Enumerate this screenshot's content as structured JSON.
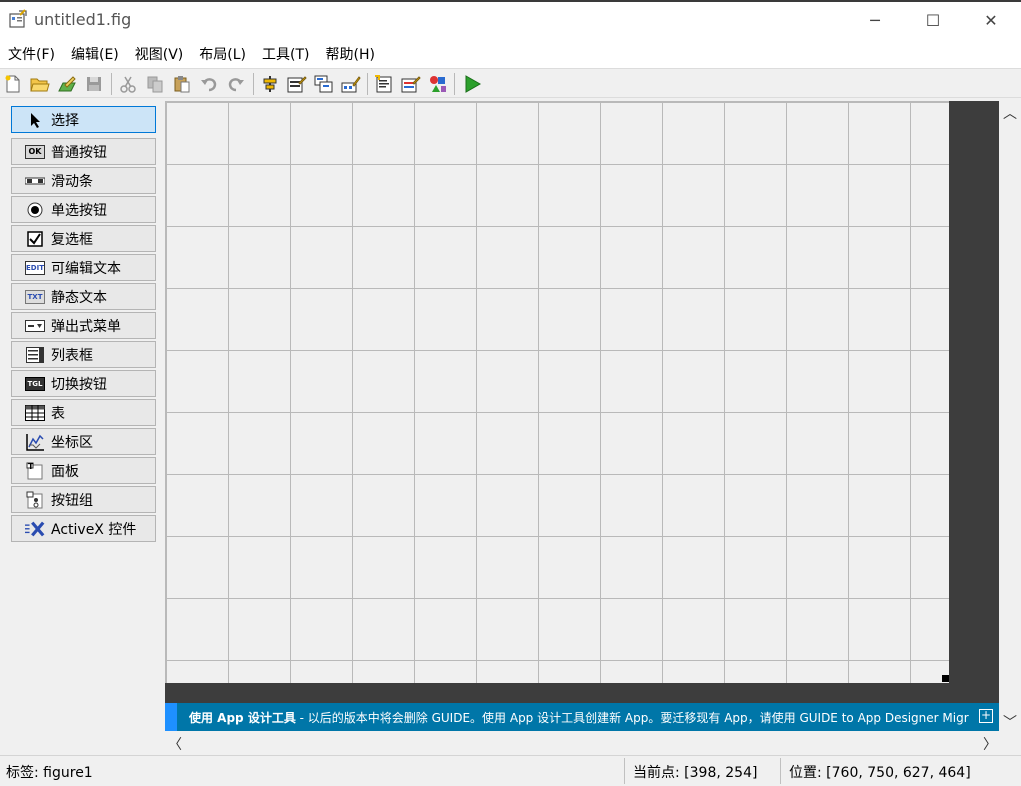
{
  "window": {
    "title": "untitled1.fig",
    "minimize": "─",
    "maximize": "☐",
    "close": "✕"
  },
  "menu": [
    {
      "label": "文件(F)"
    },
    {
      "label": "编辑(E)"
    },
    {
      "label": "视图(V)"
    },
    {
      "label": "布局(L)"
    },
    {
      "label": "工具(T)"
    },
    {
      "label": "帮助(H)"
    }
  ],
  "toolbar": {
    "icons": [
      "new-file-icon",
      "open-folder-icon",
      "edit-icon",
      "save-icon",
      "cut-icon",
      "copy-icon",
      "paste-icon",
      "undo-icon",
      "redo-icon",
      "align-icon",
      "menu-editor-icon",
      "tab-order-icon",
      "toolbar-editor-icon",
      "mfile-editor-icon",
      "property-inspector-icon",
      "object-browser-icon",
      "run-icon"
    ]
  },
  "palette": {
    "items": [
      {
        "label": "选择",
        "icon": "arrow-cursor-icon"
      },
      {
        "label": "普通按钮",
        "icon": "push-button-icon"
      },
      {
        "label": "滑动条",
        "icon": "slider-icon"
      },
      {
        "label": "单选按钮",
        "icon": "radio-button-icon"
      },
      {
        "label": "复选框",
        "icon": "checkbox-icon"
      },
      {
        "label": "可编辑文本",
        "icon": "edit-text-icon"
      },
      {
        "label": "静态文本",
        "icon": "static-text-icon"
      },
      {
        "label": "弹出式菜单",
        "icon": "popup-menu-icon"
      },
      {
        "label": "列表框",
        "icon": "listbox-icon"
      },
      {
        "label": "切换按钮",
        "icon": "toggle-button-icon"
      },
      {
        "label": "表",
        "icon": "table-icon"
      },
      {
        "label": "坐标区",
        "icon": "axes-icon"
      },
      {
        "label": "面板",
        "icon": "panel-icon"
      },
      {
        "label": "按钮组",
        "icon": "button-group-icon"
      },
      {
        "label": "ActiveX 控件",
        "icon": "activex-icon"
      }
    ],
    "icon_text": {
      "ok": "OK",
      "edit": "EDIT",
      "txt": "TXT",
      "tgl": "TGL",
      "axes_t": "T"
    }
  },
  "banner": {
    "bold": "使用 App 设计工具",
    "text": " - 以后的版本中将会删除 GUIDE。使用 App 设计工具创建新 App。要迁移现有 App，请使用 GUIDE to App Designer Migration...",
    "expand": "+"
  },
  "scroll": {
    "up": "︿",
    "down": "﹀",
    "left": "〈",
    "right": "〉"
  },
  "status": {
    "tag": "标签: figure1",
    "current_point": "当前点:  [398, 254]",
    "position": "位置: [760, 750, 627, 464]"
  },
  "colors": {
    "banner": "#0076a8",
    "selected": "#cce4f7",
    "run": "#2ca02c"
  }
}
